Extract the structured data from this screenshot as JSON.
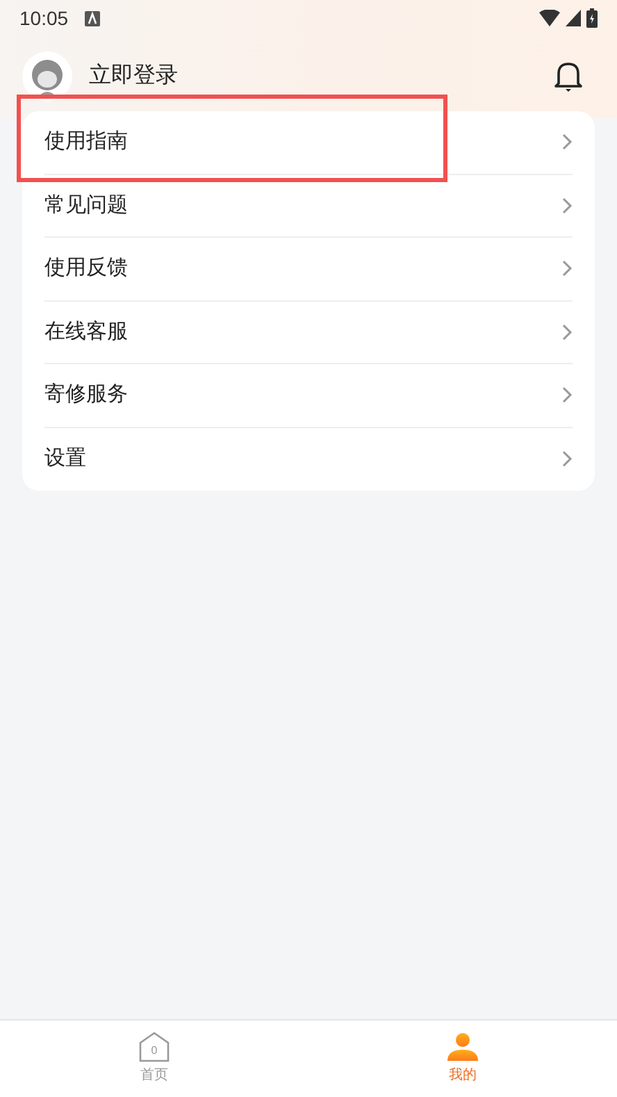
{
  "status_bar": {
    "time": "10:05"
  },
  "header": {
    "login_label": "立即登录"
  },
  "menu": [
    {
      "label": "使用指南",
      "highlighted": true
    },
    {
      "label": "常见问题",
      "highlighted": false
    },
    {
      "label": "使用反馈",
      "highlighted": false
    },
    {
      "label": "在线客服",
      "highlighted": false
    },
    {
      "label": "寄修服务",
      "highlighted": false
    },
    {
      "label": "设置",
      "highlighted": false
    }
  ],
  "bottom_nav": [
    {
      "label": "首页",
      "kind": "home",
      "badge": "0",
      "selected": false
    },
    {
      "label": "我的",
      "kind": "profile",
      "selected": true
    }
  ]
}
